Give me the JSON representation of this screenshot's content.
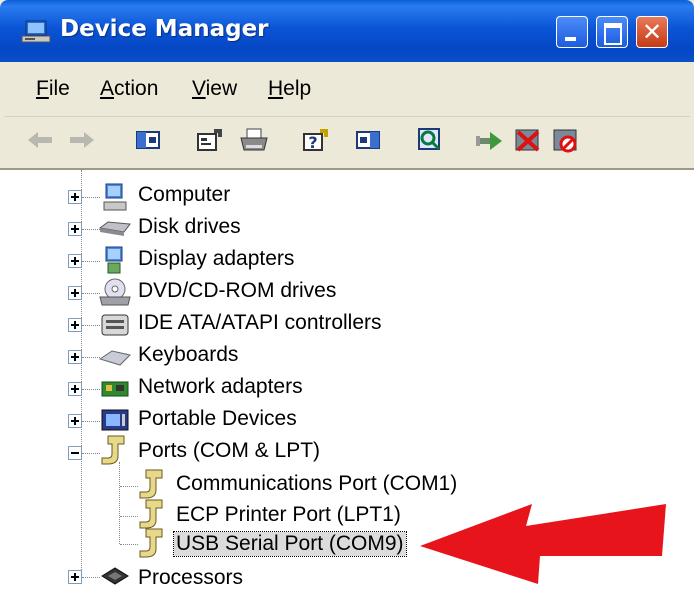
{
  "window": {
    "title": "Device Manager"
  },
  "menu": [
    {
      "label": "File",
      "key": "F",
      "rest": "ile"
    },
    {
      "label": "Action",
      "key": "A",
      "rest": "ction"
    },
    {
      "label": "View",
      "key": "V",
      "rest": "iew"
    },
    {
      "label": "Help",
      "key": "H",
      "rest": "elp"
    }
  ],
  "toolbar": [
    "back-icon",
    "forward-icon",
    "show-hide-tree-icon",
    "properties-icon",
    "print-icon",
    "help-icon",
    "console-tree-icon",
    "scan-hardware-icon",
    "update-driver-icon",
    "uninstall-icon",
    "disable-icon"
  ],
  "tree": {
    "categories": [
      "Computer",
      "Disk drives",
      "Display adapters",
      "DVD/CD-ROM drives",
      "IDE ATA/ATAPI controllers",
      "Keyboards",
      "Network adapters",
      "Portable Devices",
      "Ports (COM & LPT)",
      "Processors"
    ],
    "ports": [
      "Communications Port (COM1)",
      "ECP Printer Port (LPT1)",
      "USB Serial Port (COM9)"
    ],
    "selected": "USB Serial Port (COM9)"
  },
  "annotation": {
    "arrow_color": "#e8141c"
  }
}
